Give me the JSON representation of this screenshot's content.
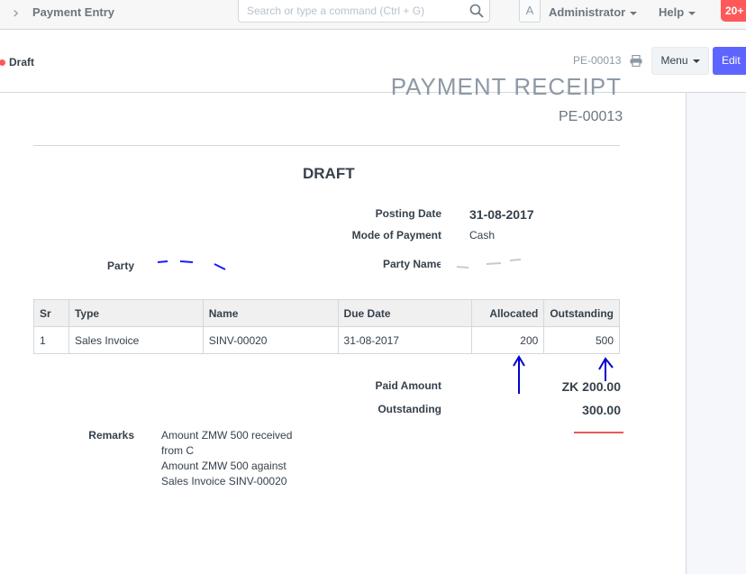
{
  "navbar": {
    "breadcrumb": "Payment Entry",
    "search_placeholder": "Search or type a command (Ctrl + G)",
    "avatar_letter": "A",
    "user_menu": "Administrator",
    "help_menu": "Help",
    "notifications": "20+"
  },
  "page_head": {
    "status": "Draft",
    "doc_id": "PE-00013",
    "menu_label": "Menu",
    "edit_label": "Edit"
  },
  "print": {
    "heading": "PAYMENT RECEIPT",
    "doc_name": "PE-00013",
    "draft_title": "DRAFT",
    "posting_date_label": "Posting Date",
    "posting_date": "31-08-2017",
    "mode_label": "Mode of Payment",
    "mode": "Cash",
    "party_label": "Party",
    "party_name_label": "Party Name",
    "table": {
      "headers": [
        "Sr",
        "Type",
        "Name",
        "Due Date",
        "Allocated",
        "Outstanding"
      ],
      "rows": [
        {
          "sr": "1",
          "type": "Sales Invoice",
          "name": "SINV-00020",
          "due_date": "31-08-2017",
          "allocated": "200",
          "outstanding": "500"
        }
      ]
    },
    "paid_amount_label": "Paid Amount",
    "paid_amount": "ZK 200.00",
    "outstanding_label": "Outstanding",
    "outstanding": "300.00",
    "remarks_label": "Remarks",
    "remarks_lines": [
      "Amount ZMW 500 received",
      "from C",
      "Amount ZMW 500 against",
      "Sales Invoice SINV-00020"
    ]
  },
  "colors": {
    "accent": "#5e64ff",
    "status_draft": "#ff5858",
    "annotation_blue": "#0000cc",
    "annotation_red": "#e02020"
  }
}
